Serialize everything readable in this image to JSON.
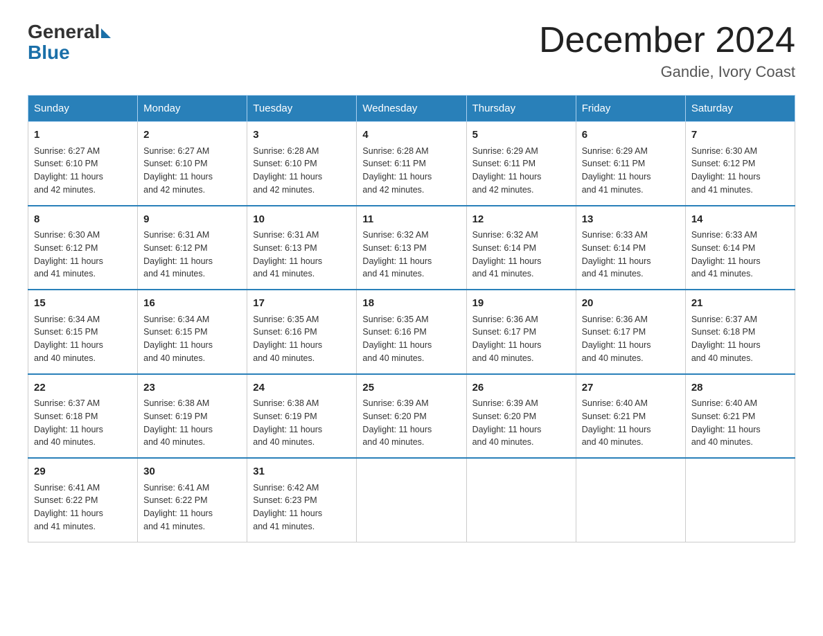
{
  "header": {
    "logo_general": "General",
    "logo_blue": "Blue",
    "title": "December 2024",
    "location": "Gandie, Ivory Coast"
  },
  "days_of_week": [
    "Sunday",
    "Monday",
    "Tuesday",
    "Wednesday",
    "Thursday",
    "Friday",
    "Saturday"
  ],
  "weeks": [
    [
      {
        "num": "1",
        "sunrise": "6:27 AM",
        "sunset": "6:10 PM",
        "daylight": "11 hours and 42 minutes."
      },
      {
        "num": "2",
        "sunrise": "6:27 AM",
        "sunset": "6:10 PM",
        "daylight": "11 hours and 42 minutes."
      },
      {
        "num": "3",
        "sunrise": "6:28 AM",
        "sunset": "6:10 PM",
        "daylight": "11 hours and 42 minutes."
      },
      {
        "num": "4",
        "sunrise": "6:28 AM",
        "sunset": "6:11 PM",
        "daylight": "11 hours and 42 minutes."
      },
      {
        "num": "5",
        "sunrise": "6:29 AM",
        "sunset": "6:11 PM",
        "daylight": "11 hours and 42 minutes."
      },
      {
        "num": "6",
        "sunrise": "6:29 AM",
        "sunset": "6:11 PM",
        "daylight": "11 hours and 41 minutes."
      },
      {
        "num": "7",
        "sunrise": "6:30 AM",
        "sunset": "6:12 PM",
        "daylight": "11 hours and 41 minutes."
      }
    ],
    [
      {
        "num": "8",
        "sunrise": "6:30 AM",
        "sunset": "6:12 PM",
        "daylight": "11 hours and 41 minutes."
      },
      {
        "num": "9",
        "sunrise": "6:31 AM",
        "sunset": "6:12 PM",
        "daylight": "11 hours and 41 minutes."
      },
      {
        "num": "10",
        "sunrise": "6:31 AM",
        "sunset": "6:13 PM",
        "daylight": "11 hours and 41 minutes."
      },
      {
        "num": "11",
        "sunrise": "6:32 AM",
        "sunset": "6:13 PM",
        "daylight": "11 hours and 41 minutes."
      },
      {
        "num": "12",
        "sunrise": "6:32 AM",
        "sunset": "6:14 PM",
        "daylight": "11 hours and 41 minutes."
      },
      {
        "num": "13",
        "sunrise": "6:33 AM",
        "sunset": "6:14 PM",
        "daylight": "11 hours and 41 minutes."
      },
      {
        "num": "14",
        "sunrise": "6:33 AM",
        "sunset": "6:14 PM",
        "daylight": "11 hours and 41 minutes."
      }
    ],
    [
      {
        "num": "15",
        "sunrise": "6:34 AM",
        "sunset": "6:15 PM",
        "daylight": "11 hours and 40 minutes."
      },
      {
        "num": "16",
        "sunrise": "6:34 AM",
        "sunset": "6:15 PM",
        "daylight": "11 hours and 40 minutes."
      },
      {
        "num": "17",
        "sunrise": "6:35 AM",
        "sunset": "6:16 PM",
        "daylight": "11 hours and 40 minutes."
      },
      {
        "num": "18",
        "sunrise": "6:35 AM",
        "sunset": "6:16 PM",
        "daylight": "11 hours and 40 minutes."
      },
      {
        "num": "19",
        "sunrise": "6:36 AM",
        "sunset": "6:17 PM",
        "daylight": "11 hours and 40 minutes."
      },
      {
        "num": "20",
        "sunrise": "6:36 AM",
        "sunset": "6:17 PM",
        "daylight": "11 hours and 40 minutes."
      },
      {
        "num": "21",
        "sunrise": "6:37 AM",
        "sunset": "6:18 PM",
        "daylight": "11 hours and 40 minutes."
      }
    ],
    [
      {
        "num": "22",
        "sunrise": "6:37 AM",
        "sunset": "6:18 PM",
        "daylight": "11 hours and 40 minutes."
      },
      {
        "num": "23",
        "sunrise": "6:38 AM",
        "sunset": "6:19 PM",
        "daylight": "11 hours and 40 minutes."
      },
      {
        "num": "24",
        "sunrise": "6:38 AM",
        "sunset": "6:19 PM",
        "daylight": "11 hours and 40 minutes."
      },
      {
        "num": "25",
        "sunrise": "6:39 AM",
        "sunset": "6:20 PM",
        "daylight": "11 hours and 40 minutes."
      },
      {
        "num": "26",
        "sunrise": "6:39 AM",
        "sunset": "6:20 PM",
        "daylight": "11 hours and 40 minutes."
      },
      {
        "num": "27",
        "sunrise": "6:40 AM",
        "sunset": "6:21 PM",
        "daylight": "11 hours and 40 minutes."
      },
      {
        "num": "28",
        "sunrise": "6:40 AM",
        "sunset": "6:21 PM",
        "daylight": "11 hours and 40 minutes."
      }
    ],
    [
      {
        "num": "29",
        "sunrise": "6:41 AM",
        "sunset": "6:22 PM",
        "daylight": "11 hours and 41 minutes."
      },
      {
        "num": "30",
        "sunrise": "6:41 AM",
        "sunset": "6:22 PM",
        "daylight": "11 hours and 41 minutes."
      },
      {
        "num": "31",
        "sunrise": "6:42 AM",
        "sunset": "6:23 PM",
        "daylight": "11 hours and 41 minutes."
      },
      null,
      null,
      null,
      null
    ]
  ],
  "labels": {
    "sunrise": "Sunrise:",
    "sunset": "Sunset:",
    "daylight": "Daylight:"
  }
}
